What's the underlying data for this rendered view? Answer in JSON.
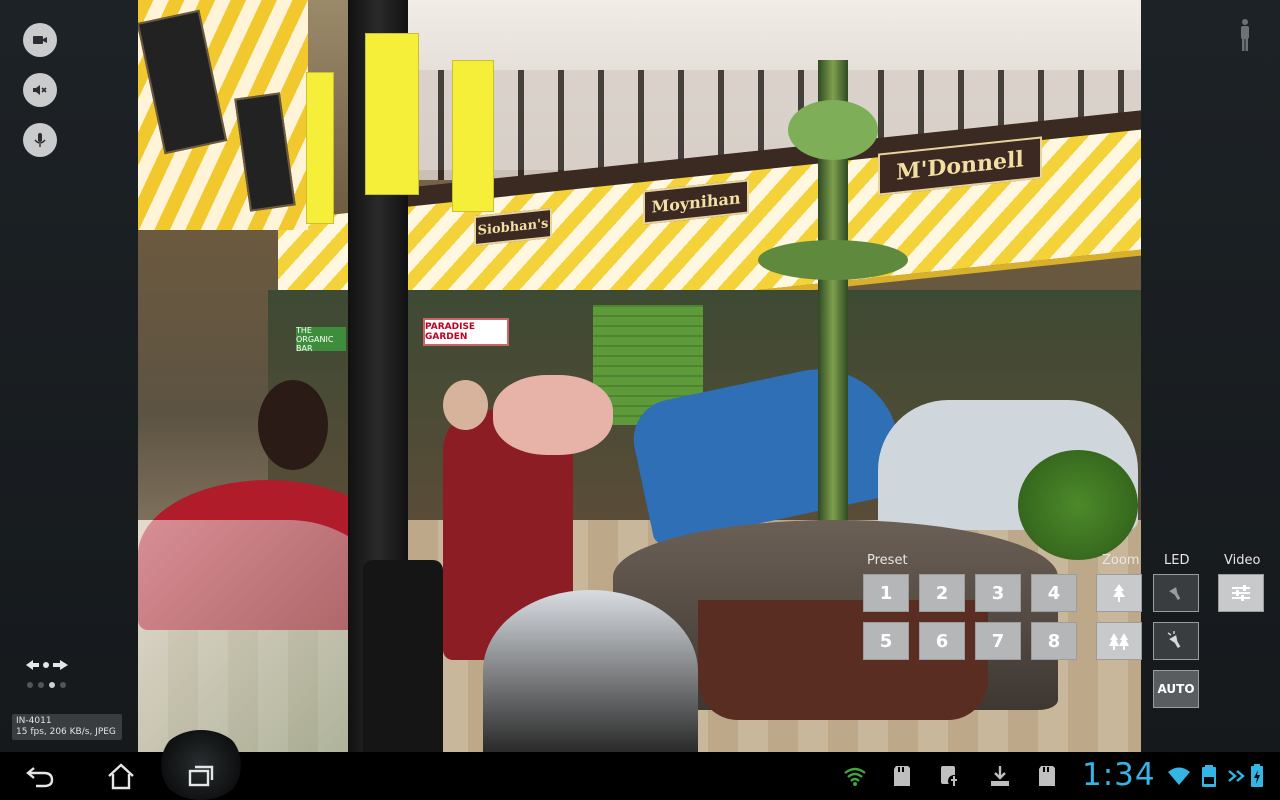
{
  "left_panel": {
    "buttons": [
      {
        "name": "video-camera-button",
        "icon": "video-camera-icon"
      },
      {
        "name": "speaker-mute-button",
        "icon": "speaker-mute-icon"
      },
      {
        "name": "microphone-button",
        "icon": "microphone-icon"
      }
    ],
    "page_dots": {
      "count": 4,
      "active_index": 2
    },
    "stats": {
      "camera_model": "IN-4011",
      "stream_info": "15 fps, 206 KB/s, JPEG"
    }
  },
  "scene_text": {
    "sign_1": "M'Donnell",
    "sign_2": "Moynihan",
    "sign_3": "Siobhan's",
    "sign_4": "PARADISE GARDEN",
    "sign_5": "THE ORGANIC BAR"
  },
  "controls": {
    "preset_label": "Preset",
    "zoom_label": "Zoom",
    "led_label": "LED",
    "video_label": "Video",
    "presets": [
      "1",
      "2",
      "3",
      "4",
      "5",
      "6",
      "7",
      "8"
    ],
    "auto_label": "AUTO"
  },
  "system_bar": {
    "time": "1:34",
    "accent_color": "#33b5e5",
    "icons": [
      "back-icon",
      "home-icon",
      "recent-apps-icon",
      "signal-icon",
      "sd-card-icon",
      "usb-debug-icon",
      "download-icon",
      "sd-card-icon",
      "wifi-icon",
      "keyboard-battery-icon",
      "arrows-icon",
      "battery-icon"
    ]
  }
}
